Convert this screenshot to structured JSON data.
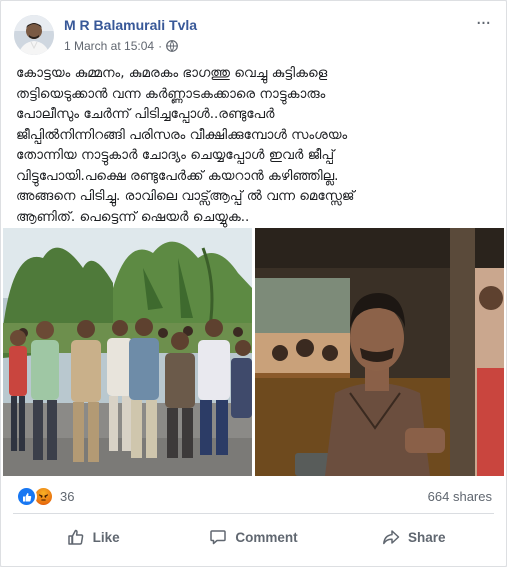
{
  "post": {
    "author": "M R Balamurali Tvla",
    "timestamp": "1 March at 15:04",
    "separator": "·",
    "privacy_icon": "globe-icon",
    "more_icon": "more-options-icon",
    "more_glyph": "···",
    "text": "കോട്ടയം കുമ്മനം, കുമരകം ഭാഗത്തു വെച്ചു കുട്ടികളെ\nതട്ടിയെടുക്കാൻ വന്ന കർണ്ണാടകക്കാരെ നാട്ടുകാരും\nപോലീസും ചേർന്ന് പിടിച്ചപ്പോൾ..രണ്ടുപേർ\nജീപ്പിൽനിന്നിറങ്ങി പരിസരം വീക്ഷിക്കുമ്പോൾ സംശയം\nതോന്നിയ നാട്ടുകാർ ചോദ്യം ചെയ്യപ്പോൾ ഇവർ ജീപ്പ്\nവിട്ടുപോയി.പക്ഷെ രണ്ടുപേർക്ക് കയറാൻ കഴിഞ്ഞില്ല.\nഅങ്ങനെ പിടിച്ചു. രാവിലെ വാട്സ്ആപ്പ് ൽ വന്ന മെസ്സേജ്\nആണിത്. പെട്ടെന്ന് ഷെയർ ചെയ്യുക.."
  },
  "photos": [
    {
      "name": "crowd-street-photo"
    },
    {
      "name": "man-in-vehicle-photo"
    }
  ],
  "engagement": {
    "reactions_count": "36",
    "reaction_icons": [
      "like-reaction-icon",
      "angry-reaction-icon"
    ],
    "shares_label": "664 shares"
  },
  "actions": {
    "like_label": "Like",
    "comment_label": "Comment",
    "share_label": "Share"
  },
  "colors": {
    "author_link": "#385898",
    "meta_text": "#616770",
    "like_blue": "#1877f2",
    "angry_orange": "#e9710f"
  }
}
